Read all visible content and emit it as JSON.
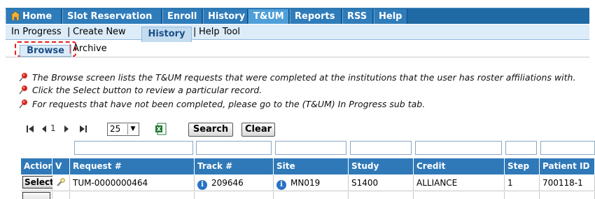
{
  "top_nav": {
    "tabs": [
      {
        "label": "Home",
        "active": false
      },
      {
        "label": "Slot Reservation",
        "active": false
      },
      {
        "label": "Enroll",
        "active": false
      },
      {
        "label": "History",
        "active": false
      },
      {
        "label": "T&UM",
        "active": true
      },
      {
        "label": "Reports",
        "active": false
      },
      {
        "label": "RSS",
        "active": false
      },
      {
        "label": "Help",
        "active": false
      }
    ]
  },
  "sub_nav": {
    "items": [
      "In Progress",
      "Create New",
      "History",
      "Help Tool"
    ],
    "active": "History",
    "separator": "|"
  },
  "sub_sub_nav": {
    "items": [
      "Browse",
      "Archive"
    ],
    "active": "Browse",
    "separator": "|"
  },
  "info_lines": [
    "The Browse screen lists the T&UM requests that were completed at the institutions that the user has roster affiliations with.",
    "Click the Select button to review a particular record.",
    "For requests that have not been completed, please go to the (T&UM) In Progress sub tab."
  ],
  "pager": {
    "page": "1",
    "page_size": "25",
    "search_label": "Search",
    "clear_label": "Clear"
  },
  "grid": {
    "columns": [
      "Action",
      "V",
      "Request #",
      "Track #",
      "Site",
      "Study",
      "Credit",
      "Step",
      "Patient ID"
    ],
    "rows": [
      {
        "action": "Select",
        "request": "TUM-0000000464",
        "track": "209646",
        "site": "MN019",
        "study": "S1400",
        "credit": "ALLIANCE",
        "step": "1",
        "patient": "700118-1"
      }
    ]
  },
  "colors": {
    "nav_bg": "#1f6aa5",
    "tab_bg": "#2f7cba",
    "tab_active": "#4e9fd9",
    "subnav_bg": "#dcecf8",
    "grid_header": "#2f79b8",
    "highlight_dash": "#e0201a"
  },
  "icons": [
    "home-icon",
    "pushpin-icon",
    "first-page-icon",
    "prev-page-icon",
    "next-page-icon",
    "last-page-icon",
    "excel-export-icon",
    "info-icon",
    "wrench-icon"
  ]
}
